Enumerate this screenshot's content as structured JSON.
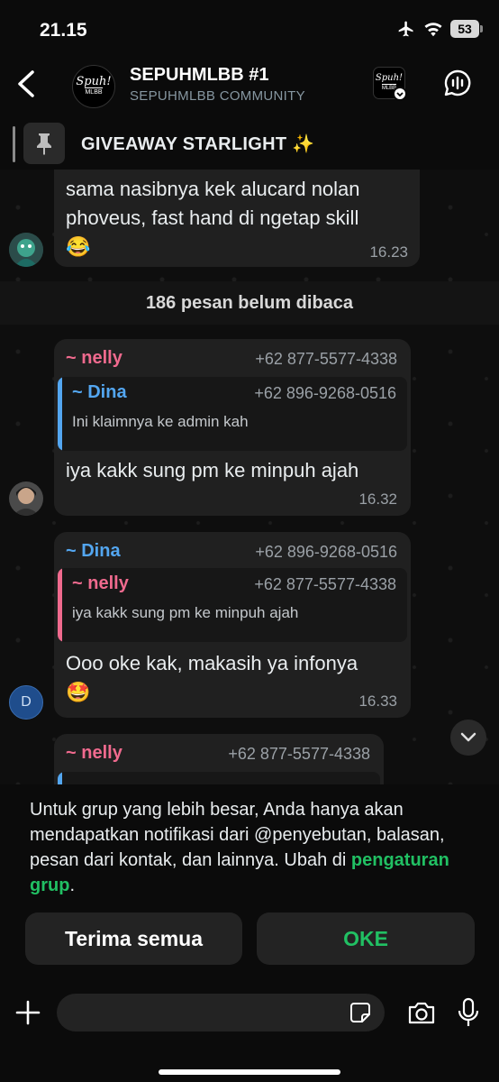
{
  "status": {
    "time": "21.15",
    "battery": "53"
  },
  "header": {
    "title": "SEPUHMLBB #1",
    "subtitle": "SEPUHMLBB COMMUNITY",
    "avatar_logo_main": "Spuh!",
    "avatar_logo_sub": "MLBB"
  },
  "pinned": {
    "text": "GIVEAWAY STARLIGHT ✨"
  },
  "messages": [
    {
      "text_line1": "sama nasibnya kek alucard nolan",
      "text_line2": "phoveus, fast hand di ngetap skill",
      "emoji": "😂",
      "time": "16.23"
    },
    {
      "sender": "~ nelly",
      "phone": "+62 877-5577-4338",
      "quote_sender": "~ Dina",
      "quote_phone": "+62 896-9268-0516",
      "quote_text": "Ini klaimnya ke admin kah",
      "text": "iya kakk sung pm ke minpuh ajah",
      "time": "16.32"
    },
    {
      "sender": "~ Dina",
      "phone": "+62 896-9268-0516",
      "quote_sender": "~ nelly",
      "quote_phone": "+62 877-5577-4338",
      "quote_text": "iya kakk sung pm ke minpuh ajah",
      "text": "Ooo oke kak, makasih ya infonya",
      "emoji": "🤩",
      "time": "16.33",
      "avatar_letter": "D"
    },
    {
      "sender": "~ nelly",
      "phone": "+62 877-5577-4338"
    }
  ],
  "unread_divider": "186 pesan belum dibaca",
  "notice": {
    "text": "Untuk grup yang lebih besar, Anda hanya akan mendapatkan notifikasi dari @penyebutan, balasan, pesan dari kontak, dan lainnya. Ubah di ",
    "link": "pengaturan grup",
    "period": ".",
    "accept_all": "Terima semua",
    "ok": "OKE"
  },
  "composer": {
    "placeholder": ""
  },
  "colors": {
    "accent": "#21c063",
    "nelly": "#f06a8e",
    "dina": "#53a6f0"
  }
}
